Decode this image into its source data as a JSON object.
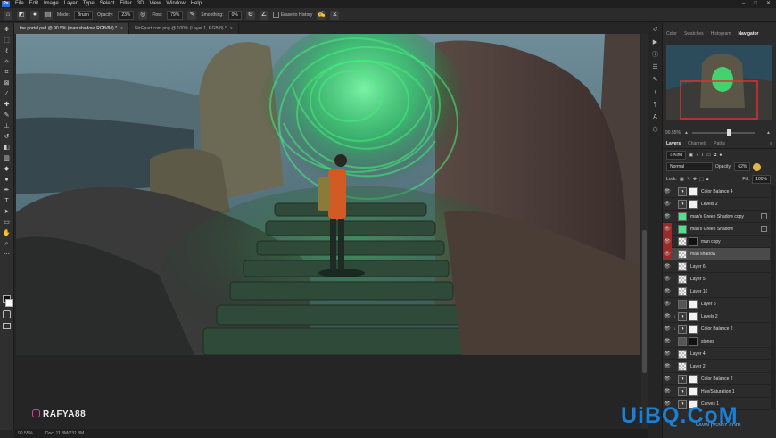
{
  "app": {
    "logo": "Ps",
    "accent": "#2a6fdb"
  },
  "menu": {
    "items": [
      "File",
      "Edit",
      "Image",
      "Layer",
      "Type",
      "Select",
      "Filter",
      "3D",
      "View",
      "Window",
      "Help"
    ],
    "window_controls": [
      "–",
      "□",
      "✕"
    ]
  },
  "options_bar": {
    "mode_label": "Mode:",
    "mode_value": "Brush",
    "opacity_label": "Opacity:",
    "opacity_value": "23%",
    "flow_label": "Flow:",
    "flow_value": "79%",
    "smoothing_label": "Smoothing:",
    "smoothing_value": "0%",
    "erase_history_label": "Erase to History"
  },
  "tools": [
    "move-icon",
    "marquee-icon",
    "lasso-icon",
    "quick-select-icon",
    "crop-icon",
    "frame-icon",
    "eyedropper-icon",
    "healing-icon",
    "brush-icon",
    "stamp-icon",
    "history-brush-icon",
    "eraser-icon",
    "gradient-icon",
    "blur-icon",
    "dodge-icon",
    "pen-icon",
    "type-icon",
    "path-select-icon",
    "rectangle-icon",
    "hand-icon",
    "zoom-icon"
  ],
  "doc_tabs": [
    {
      "label": "the portal.psd @ 90.5% (man shadow, RGB/8#) *",
      "active": true
    },
    {
      "label": "NicEpart.com.png @ 100% (Layer 1, RGB/8) *",
      "active": false
    }
  ],
  "watermark": {
    "text": "RAFYA88",
    "icon": "instagram-icon"
  },
  "status": {
    "zoom": "90.55%",
    "doc": "Doc: 11.8M/231.8M"
  },
  "navigator": {
    "tabs": [
      {
        "label": "Color",
        "active": false
      },
      {
        "label": "Swatches",
        "active": false
      },
      {
        "label": "Histogram",
        "active": false
      },
      {
        "label": "Navigator",
        "active": true
      }
    ],
    "zoom": "90.55%"
  },
  "layers_panel": {
    "tabs": [
      {
        "label": "Layers",
        "active": true
      },
      {
        "label": "Channels",
        "active": false
      },
      {
        "label": "Paths",
        "active": false
      }
    ],
    "filter_kind": "Kind",
    "blend_mode": "Normal",
    "opacity_label": "Opacity:",
    "opacity_value": "62%",
    "lock_label": "Lock:",
    "fill_label": "Fill:",
    "fill_value": "100%",
    "layers": [
      {
        "name": "Color Balance 4",
        "eye": true,
        "red": false,
        "clip": "",
        "thumb": "adj",
        "mask": "white",
        "fx": false,
        "selected": false
      },
      {
        "name": "Levels 2",
        "eye": true,
        "red": false,
        "clip": "",
        "thumb": "adj",
        "mask": "white",
        "fx": false,
        "selected": false
      },
      {
        "name": "man's Green Shadow copy",
        "eye": true,
        "red": false,
        "clip": "",
        "thumb": "green",
        "mask": "",
        "fx": true,
        "selected": false
      },
      {
        "name": "man's Green Shadow",
        "eye": true,
        "red": true,
        "clip": "",
        "thumb": "green",
        "mask": "",
        "fx": true,
        "selected": false
      },
      {
        "name": "man copy",
        "eye": true,
        "red": true,
        "clip": "",
        "thumb": "checker",
        "mask": "black",
        "fx": false,
        "selected": false
      },
      {
        "name": "man shadow",
        "eye": true,
        "red": true,
        "clip": "",
        "thumb": "checker",
        "mask": "",
        "fx": false,
        "selected": true
      },
      {
        "name": "Layer 6",
        "eye": true,
        "red": false,
        "clip": "",
        "thumb": "checker",
        "mask": "",
        "fx": false,
        "selected": false
      },
      {
        "name": "Layer 5",
        "eye": true,
        "red": false,
        "clip": "",
        "thumb": "checker",
        "mask": "",
        "fx": false,
        "selected": false
      },
      {
        "name": "Layer 10",
        "eye": true,
        "red": false,
        "clip": "",
        "thumb": "checker",
        "mask": "",
        "fx": false,
        "selected": false
      },
      {
        "name": "Layer 5",
        "eye": true,
        "red": false,
        "clip": "",
        "thumb": "dark",
        "mask": "white",
        "fx": false,
        "selected": false
      },
      {
        "name": "Levels 2",
        "eye": true,
        "red": false,
        "clip": "↓",
        "thumb": "adj",
        "mask": "white",
        "fx": false,
        "selected": false
      },
      {
        "name": "Color Balance 2",
        "eye": true,
        "red": false,
        "clip": "↓",
        "thumb": "adj",
        "mask": "white",
        "fx": false,
        "selected": false
      },
      {
        "name": "stones",
        "eye": true,
        "red": false,
        "clip": "",
        "thumb": "dark",
        "mask": "black",
        "fx": false,
        "selected": false
      },
      {
        "name": "Layer 4",
        "eye": true,
        "red": false,
        "clip": "",
        "thumb": "checker",
        "mask": "",
        "fx": false,
        "selected": false
      },
      {
        "name": "Layer 2",
        "eye": true,
        "red": false,
        "clip": "",
        "thumb": "checker",
        "mask": "",
        "fx": false,
        "selected": false
      },
      {
        "name": "Color Balance 2",
        "eye": true,
        "red": false,
        "clip": "",
        "thumb": "adj",
        "mask": "white",
        "fx": false,
        "selected": false
      },
      {
        "name": "Hue/Saturation 1",
        "eye": true,
        "red": false,
        "clip": "",
        "thumb": "adj",
        "mask": "white",
        "fx": false,
        "selected": false
      },
      {
        "name": "Curves 1",
        "eye": true,
        "red": false,
        "clip": "",
        "thumb": "adj",
        "mask": "white",
        "fx": false,
        "selected": false
      }
    ]
  },
  "brand": {
    "logo": "UiBQ.CoM",
    "sub": "www.psahz.com",
    "color": "#1b7fd6"
  }
}
